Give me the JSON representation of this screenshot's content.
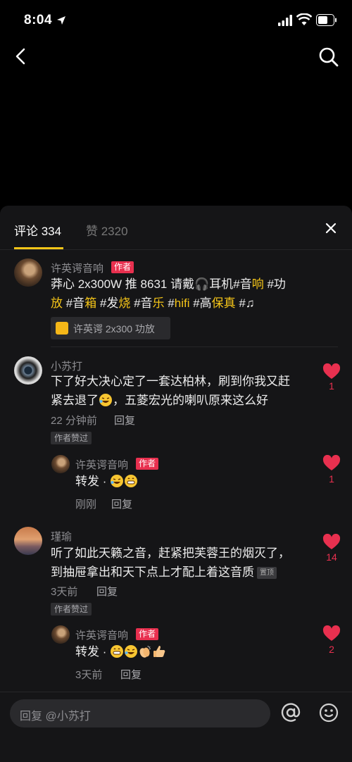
{
  "status_bar": {
    "time": "8:04"
  },
  "tabs": {
    "comments": "评论 334",
    "likes": "赞 2320"
  },
  "comments": [
    {
      "author": "许英谔音响",
      "badge": "作者",
      "text_parts": [
        {
          "t": "莽心 2x300W 推 8631 请戴",
          "hl": false
        },
        {
          "t": "🎧",
          "emoji": true
        },
        {
          "t": "耳机#音",
          "hl": false
        },
        {
          "t": "响",
          "hl": true
        },
        {
          "t": " #功",
          "hl": false
        },
        {
          "t": "放",
          "hl": true
        },
        {
          "t": " #音",
          "hl": false
        },
        {
          "t": "箱",
          "hl": true
        },
        {
          "t": " #发",
          "hl": false
        },
        {
          "t": "烧",
          "hl": true
        },
        {
          "t": " #音",
          "hl": false
        },
        {
          "t": "乐",
          "hl": true
        },
        {
          "t": " #",
          "hl": false
        },
        {
          "t": "hifi",
          "hl": true
        },
        {
          "t": " #高",
          "hl": false
        },
        {
          "t": "保真",
          "hl": true
        },
        {
          "t": " #",
          "hl": false
        },
        {
          "t": "♫",
          "hl": false
        }
      ],
      "product": "许英谔 2x300 功放"
    },
    {
      "author": "小苏打",
      "line1": "下了好大决心定了一套达柏林，刷到你我又赶",
      "line2": "紧去退了",
      "line2b": "，五菱宏光的喇叭原来这么好",
      "time": "22 分钟前",
      "reply": "回复",
      "liked_tag": "作者赞过",
      "likes": "1",
      "sub": {
        "author": "许英谔音响",
        "badge": "作者",
        "text": "转发 ·",
        "time": "刚刚",
        "reply": "回复",
        "likes": "1"
      }
    },
    {
      "author": "瑾瑜",
      "line1": "听了如此天籁之音，赶紧把芙蓉王的烟灭了，",
      "line2": "到抽屉拿出和天下点上才配上着这音质",
      "pin": "置顶",
      "time": "3天前",
      "reply": "回复",
      "liked_tag": "作者赞过",
      "likes": "14",
      "sub": {
        "author": "许英谔音响",
        "badge": "作者",
        "text": "转发 ·",
        "time": "3天前",
        "reply": "回复",
        "likes": "2"
      }
    }
  ],
  "composer": {
    "placeholder": "回复 @小苏打"
  },
  "colors": {
    "accent": "#f5c518",
    "heart": "#e8304f",
    "sheet": "#151517"
  }
}
